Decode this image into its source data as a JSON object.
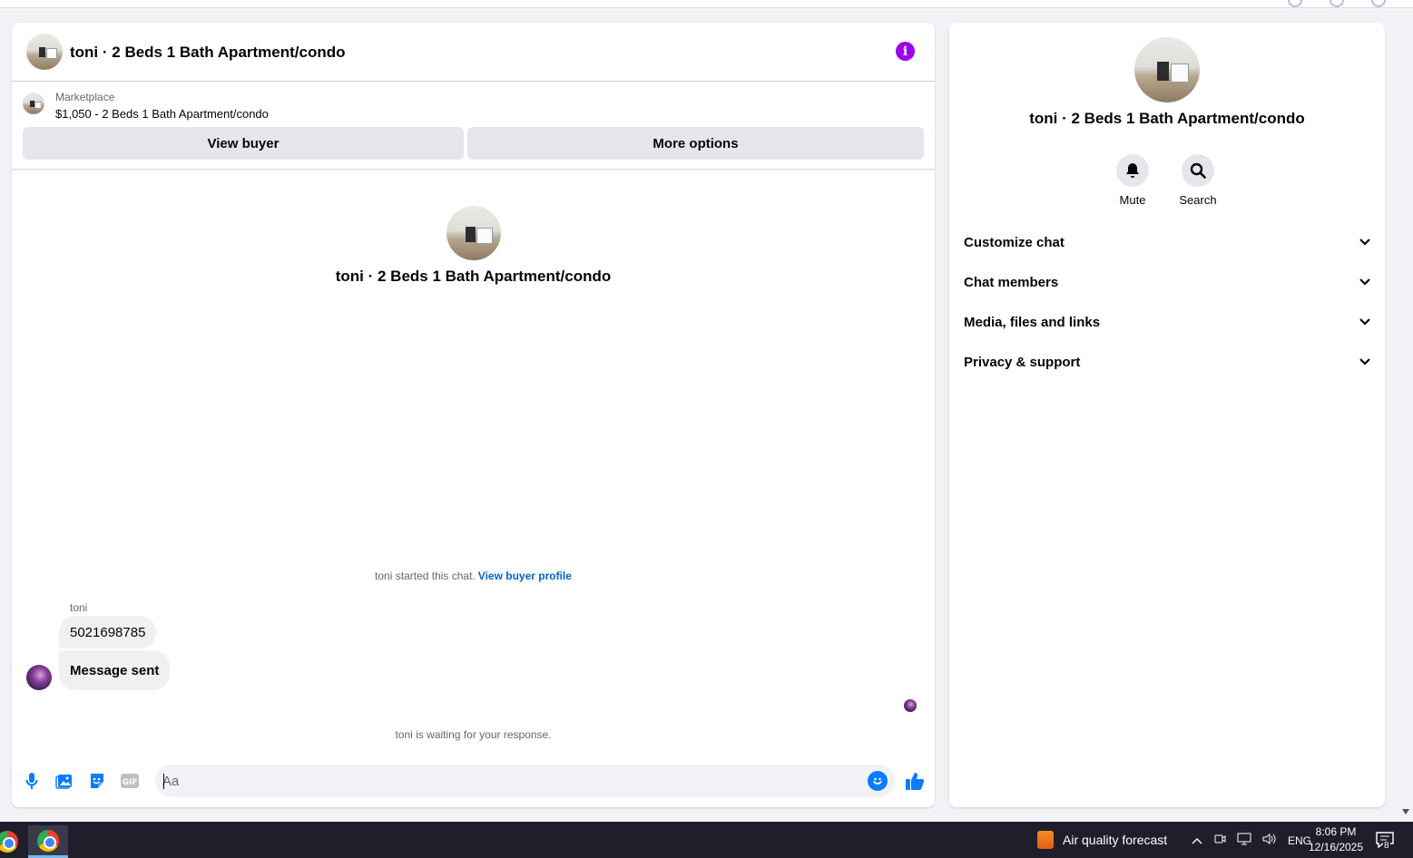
{
  "conversation": {
    "title": "toni · 2 Beds 1 Bath Apartment/condo"
  },
  "marketplace": {
    "label": "Marketplace",
    "listing": "$1,050 - 2 Beds 1 Bath Apartment/condo",
    "view_buyer": "View buyer",
    "more_options": "More options"
  },
  "thread": {
    "intro_title": "toni · 2 Beds 1 Bath Apartment/condo",
    "started_text": "toni started this chat.",
    "view_buyer_profile": "View buyer profile",
    "sender": "toni",
    "messages": [
      "5021698785",
      "Message sent"
    ],
    "waiting_text": "toni is waiting for your response."
  },
  "composer": {
    "placeholder": "Aa"
  },
  "info_panel": {
    "title": "toni · 2 Beds 1 Bath Apartment/condo",
    "actions": {
      "mute": "Mute",
      "search": "Search"
    },
    "sections": [
      "Customize chat",
      "Chat members",
      "Media, files and links",
      "Privacy & support"
    ]
  },
  "taskbar": {
    "weather": "Air quality forecast",
    "language": "ENG",
    "time": "8:06 PM",
    "date": "12/16/2025",
    "notification_count": "8"
  },
  "colors": {
    "accent": "#0a7cff",
    "info_icon": "#9c00ec",
    "link": "#0064d1"
  }
}
